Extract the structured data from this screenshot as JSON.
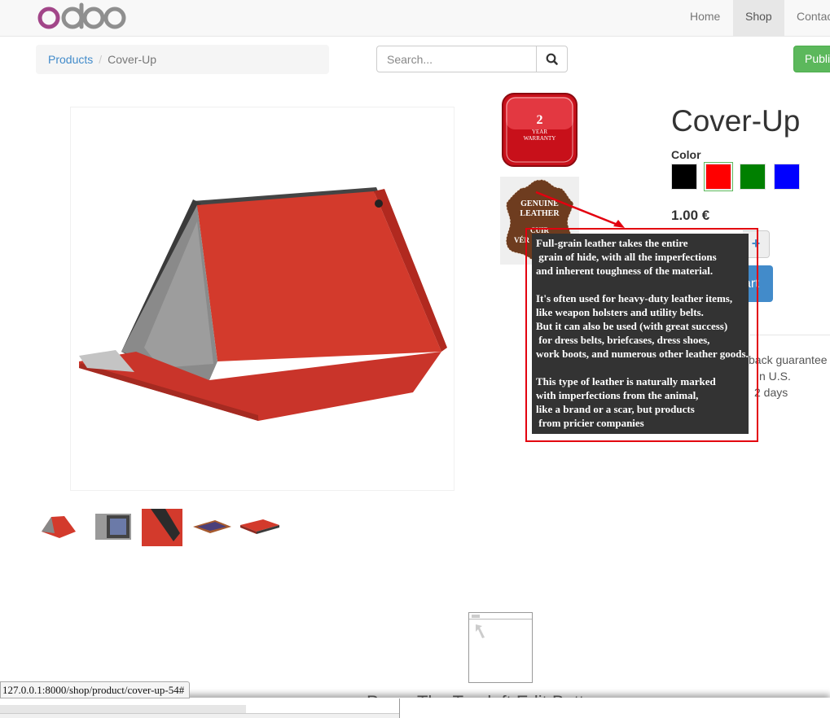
{
  "navbar": {
    "brand": "odoo",
    "items": [
      {
        "label": "Home"
      },
      {
        "label": "Shop"
      },
      {
        "label": "Contac"
      }
    ]
  },
  "breadcrumb": {
    "parent": "Products",
    "separator": "/",
    "current": "Cover-Up"
  },
  "search": {
    "placeholder": "Search...",
    "icon": "search-icon"
  },
  "publish_label": "Publi",
  "product": {
    "title": "Cover-Up",
    "color_label": "Color",
    "swatches": [
      {
        "name": "black",
        "color": "#000000"
      },
      {
        "name": "red",
        "color": "#ff0000"
      },
      {
        "name": "green",
        "color": "#008000"
      },
      {
        "name": "blue",
        "color": "#0000ff"
      }
    ],
    "selected_swatch": "red",
    "price": "1.00 €",
    "qty_plus": "+",
    "add_to_cart_partial": "art",
    "info_lines": [
      "back guarantee",
      "n U.S.",
      "2 days"
    ]
  },
  "badges": {
    "warranty": {
      "number": "2",
      "year": "YEAR",
      "word": "WARRANTY"
    },
    "leather": {
      "line1": "GENUINE",
      "line2": "LEATHER",
      "line3": "CUIR",
      "line4": "VÉR"
    }
  },
  "tooltip": {
    "text": "Full-grain leather takes the entire\n grain of hide, with all the imperfections\nand inherent toughness of the material.\n\nIt's often used for heavy-duty leather items,\nlike weapon holsters and utility belts.\nBut it can also be used (with great success)\n for dress belts, briefcases, dress shoes,\nwork boots, and numerous other leather goods.\n\nThis type of leather is naturally marked\nwith imperfections from the animal,\nlike a brand or a scar, but products\n from pricier companies",
    "highlight_color": "#e3000f"
  },
  "bottom": {
    "partial_text": "Press The Top-left Edit Butt"
  },
  "status_bar": {
    "url": "127.0.0.1:8000/shop/product/cover-up-54#"
  }
}
